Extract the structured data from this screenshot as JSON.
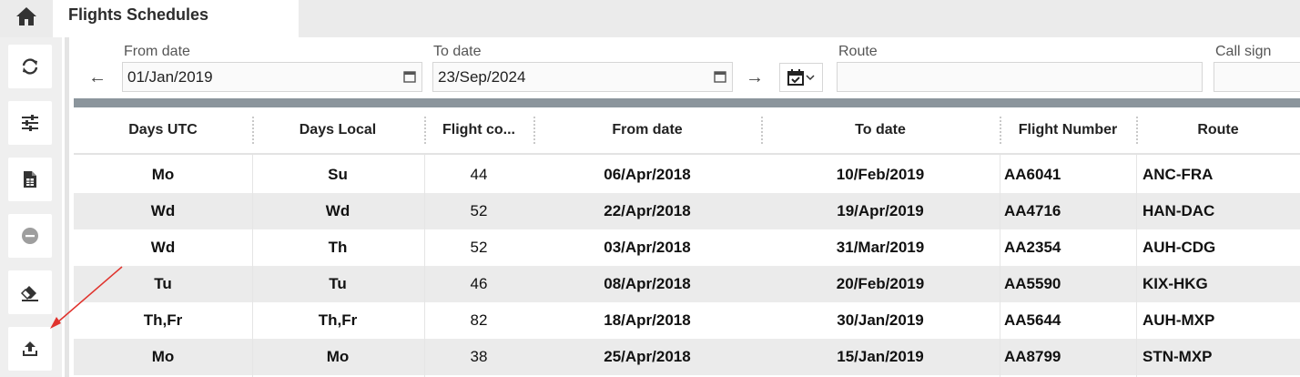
{
  "tab": {
    "title": "Flights Schedules"
  },
  "filters": {
    "from_date_label": "From date",
    "from_date_value": "01/Jan/2019",
    "to_date_label": "To date",
    "to_date_value": "23/Sep/2024",
    "route_label": "Route",
    "route_value": "",
    "callsign_label": "Call sign",
    "callsign_value": ""
  },
  "grid": {
    "columns": [
      "Days UTC",
      "Days Local",
      "Flight co...",
      "From date",
      "To date",
      "Flight Number",
      "Route"
    ],
    "rows": [
      {
        "days_utc": "Mo",
        "days_local": "Su",
        "count": "44",
        "from": "06/Apr/2018",
        "to": "10/Feb/2019",
        "flight": "AA6041",
        "route": "ANC-FRA"
      },
      {
        "days_utc": "Wd",
        "days_local": "Wd",
        "count": "52",
        "from": "22/Apr/2018",
        "to": "19/Apr/2019",
        "flight": "AA4716",
        "route": "HAN-DAC"
      },
      {
        "days_utc": "Wd",
        "days_local": "Th",
        "count": "52",
        "from": "03/Apr/2018",
        "to": "31/Mar/2019",
        "flight": "AA2354",
        "route": "AUH-CDG"
      },
      {
        "days_utc": "Tu",
        "days_local": "Tu",
        "count": "46",
        "from": "08/Apr/2018",
        "to": "20/Feb/2019",
        "flight": "AA5590",
        "route": "KIX-HKG"
      },
      {
        "days_utc": "Th,Fr",
        "days_local": "Th,Fr",
        "count": "82",
        "from": "18/Apr/2018",
        "to": "30/Jan/2019",
        "flight": "AA5644",
        "route": "AUH-MXP"
      },
      {
        "days_utc": "Mo",
        "days_local": "Mo",
        "count": "38",
        "from": "25/Apr/2018",
        "to": "15/Jan/2019",
        "flight": "AA8799",
        "route": "STN-MXP"
      }
    ]
  },
  "toolbar_icons": [
    "refresh-icon",
    "sliders-icon",
    "spreadsheet-icon",
    "minus-circle-icon",
    "eraser-icon",
    "upload-icon"
  ],
  "colors": {
    "grid_top_bar": "#8b959c",
    "annotation_arrow": "#e0322c",
    "stripe": "#ebebeb"
  }
}
